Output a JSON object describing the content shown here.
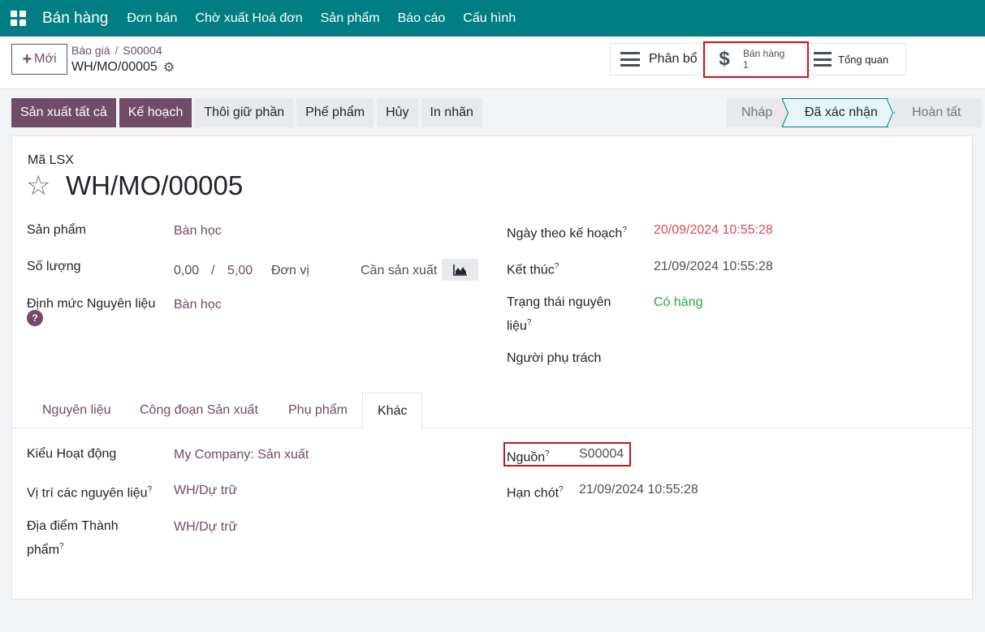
{
  "navbar": {
    "app_name": "Bán hàng",
    "menu": [
      "Đơn bán",
      "Chờ xuất Hoá đơn",
      "Sản phẩm",
      "Báo cáo",
      "Cấu hình"
    ]
  },
  "control": {
    "new_label": "Mới",
    "breadcrumb": [
      "Báo giá",
      "S00004"
    ],
    "record_name": "WH/MO/00005",
    "smart_buttons": {
      "allocate": "Phân bổ",
      "sales_label": "Bán hàng",
      "sales_count": "1",
      "overview": "Tổng quan"
    }
  },
  "statusbar": {
    "actions": [
      "Sản xuất tất cả",
      "Kế hoạch",
      "Thôi giữ phần",
      "Phế phẩm",
      "Hủy",
      "In nhãn"
    ],
    "stages": [
      "Nháp",
      "Đã xác nhận",
      "Hoàn tất"
    ],
    "current_stage": "Đã xác nhận"
  },
  "sheet": {
    "ref_label": "Mã LSX",
    "title": "WH/MO/00005",
    "left": {
      "product_label": "Sản phẩm",
      "product_value": "Bàn học",
      "qty_label": "Số lượng",
      "qty_done": "0,00",
      "qty_sep": "/",
      "qty_total": "5,00",
      "uom": "Đơn vị",
      "to_produce": "Cần sản xuất",
      "bom_label": "Định mức Nguyên liệu",
      "bom_value": "Bàn học"
    },
    "right": {
      "planned_label": "Ngày theo kế hoạch",
      "planned_value": "20/09/2024 10:55:28",
      "end_label": "Kết thúc",
      "end_value": "21/09/2024 10:55:28",
      "comp_status_label_1": "Trạng thái nguyên",
      "comp_status_label_2": "liệu",
      "comp_status_value": "Có hàng",
      "responsible_label": "Người phụ trách"
    },
    "tabs": [
      "Nguyên liệu",
      "Công đoạn Sản xuất",
      "Phụ phẩm",
      "Khác"
    ],
    "active_tab": "Khác",
    "misc": {
      "op_type_label": "Kiểu Hoạt động",
      "op_type_value": "My Company: Sản xuất",
      "comp_loc_label": "Vị trí các nguyên liệu",
      "comp_loc_value": "WH/Dự trữ",
      "fin_loc_label_1": "Địa điểm Thành",
      "fin_loc_label_2": "phẩm",
      "fin_loc_value": "WH/Dự trữ",
      "source_label": "Nguồn",
      "source_value": "S00004",
      "deadline_label": "Hạn chót",
      "deadline_value": "21/09/2024 10:55:28"
    }
  },
  "help_mark": "?",
  "colors": {
    "navbar": "#017e84",
    "primary": "#714b67",
    "highlight": "#c0191f"
  }
}
